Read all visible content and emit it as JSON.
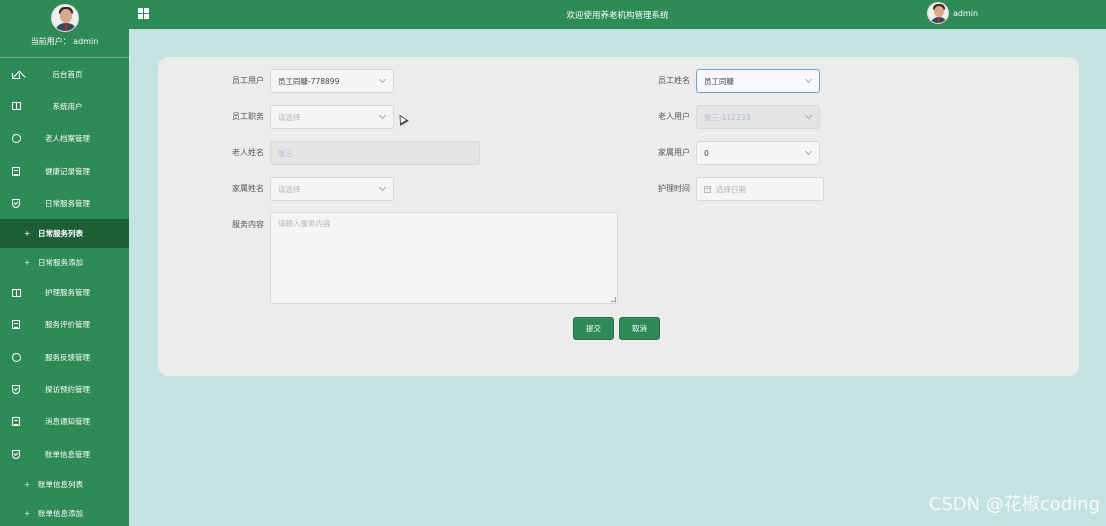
{
  "sidebar": {
    "current_user": "当前用户： admin",
    "items": [
      {
        "label": "后台首页",
        "icon": "home-icon"
      },
      {
        "label": "系统用户",
        "icon": "columns-icon"
      },
      {
        "label": "老人档案管理",
        "icon": "chat-bubble-icon"
      },
      {
        "label": "健康记录管理",
        "icon": "document-icon"
      },
      {
        "label": "日常服务管理",
        "icon": "shield-icon"
      }
    ],
    "sub_daily": [
      {
        "label": "日常服务列表",
        "active": true
      },
      {
        "label": "日常服务添加",
        "active": false
      }
    ],
    "items2": [
      {
        "label": "护理服务管理",
        "icon": "columns-icon"
      },
      {
        "label": "服务评价管理",
        "icon": "document-icon"
      },
      {
        "label": "服务反馈管理",
        "icon": "chat-bubble-icon"
      },
      {
        "label": "探访预约管理",
        "icon": "shield-icon"
      },
      {
        "label": "消息通知管理",
        "icon": "document-icon"
      },
      {
        "label": "账单信息管理",
        "icon": "shield-icon"
      }
    ],
    "sub_bill": [
      {
        "label": "账单信息列表"
      },
      {
        "label": "账单信息添加"
      }
    ],
    "plus": "+"
  },
  "topbar": {
    "title": "欢迎使用养老机构管理系统",
    "username": "admin"
  },
  "form": {
    "staff_user_label": "员工用户",
    "staff_user_value": "员工同糠-778899",
    "staff_name_label": "员工姓名",
    "staff_name_value": "员工同糠",
    "staff_role_label": "员工职务",
    "staff_role_placeholder": "请选择",
    "elder_user_label": "老人用户",
    "elder_user_value": "张三-112233",
    "elder_name_label": "老人姓名",
    "elder_name_value": "张三",
    "family_user_label": "家属用户",
    "family_user_value": "0",
    "family_name_label": "家属姓名",
    "family_name_placeholder": "请选择",
    "care_time_label": "护理时间",
    "care_time_placeholder": "选择日期",
    "content_label": "服务内容",
    "content_placeholder": "请输入服务内容",
    "submit": "提交",
    "cancel": "取消"
  },
  "watermark": "CSDN @花椒coding"
}
